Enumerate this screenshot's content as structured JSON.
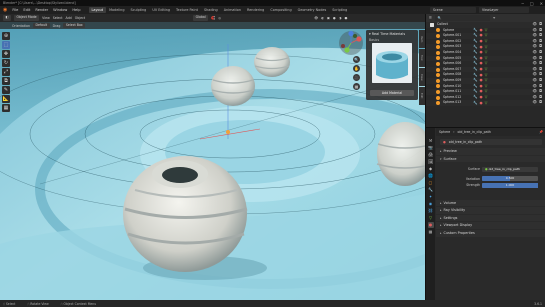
{
  "titlebar": {
    "title": "Blender* [C:\\Users\\...\\Desktop\\Stylized.blend]"
  },
  "menubar": {
    "menus": [
      "File",
      "Edit",
      "Render",
      "Window",
      "Help"
    ],
    "workspaces": [
      "Layout",
      "Modeling",
      "Sculpting",
      "UV Editing",
      "Texture Paint",
      "Shading",
      "Animation",
      "Rendering",
      "Compositing",
      "Geometry Nodes",
      "Scripting"
    ],
    "scene": "Scene",
    "view_layer": "ViewLayer"
  },
  "viewport_header": {
    "mode": "Object Mode",
    "menus": [
      "View",
      "Select",
      "Add",
      "Object"
    ],
    "orientation": "Global"
  },
  "viewport_header2": {
    "orientation_label": "Orientation",
    "orientation_value": "Default",
    "drag_label": "Drag",
    "drag_value": "Select Box"
  },
  "toolbar": {
    "icons": [
      "cursor-icon",
      "move-icon",
      "rotate-icon",
      "scale-icon",
      "transform-icon",
      "annotate-icon",
      "measure-icon",
      "add-cube-icon"
    ]
  },
  "material_panel": {
    "title": "Real Time Materials",
    "subtitle": "Basics",
    "button": "Add Material"
  },
  "side_tabs": [
    "Item",
    "Tool",
    "View",
    "Edit"
  ],
  "outliner": {
    "search_placeholder": "",
    "collection": "Collect",
    "items": [
      "Sphere",
      "Sphere.001",
      "Sphere.002",
      "Sphere.003",
      "Sphere.004",
      "Sphere.005",
      "Sphere.006",
      "Sphere.007",
      "Sphere.008",
      "Sphere.009",
      "Sphere.010",
      "Sphere.011",
      "Sphere.012",
      "Sphere.013"
    ]
  },
  "properties": {
    "breadcrumb_object": "Sphere",
    "breadcrumb_material": "old_tree_in_clip_path",
    "material_slot": "old_tree_in_clip_path",
    "sections": {
      "preview": "Preview",
      "surface": "Surface",
      "volume": "Volume",
      "ray_visibility": "Ray Visibility",
      "settings": "Settings",
      "viewport_display": "Viewport Display",
      "custom_properties": "Custom Properties"
    },
    "surface_label": "Surface",
    "surface_value": "old_tree_in_clip_path",
    "rows": [
      {
        "label": "Variation",
        "value": "0.500",
        "fraction": 0.5
      },
      {
        "label": "Strength",
        "value": "1.000",
        "fraction": 1.0
      }
    ]
  },
  "statusbar": {
    "items": [
      "Select",
      "Rotate View",
      "Object Context Menu"
    ],
    "version": "3.6.1"
  },
  "colors": {
    "accent": "#4772b3",
    "object_orange": "#f39b2a",
    "modifier_green": "#7ac943",
    "modifier_blue": "#4ba3e0",
    "water": "#9fd4e2"
  }
}
